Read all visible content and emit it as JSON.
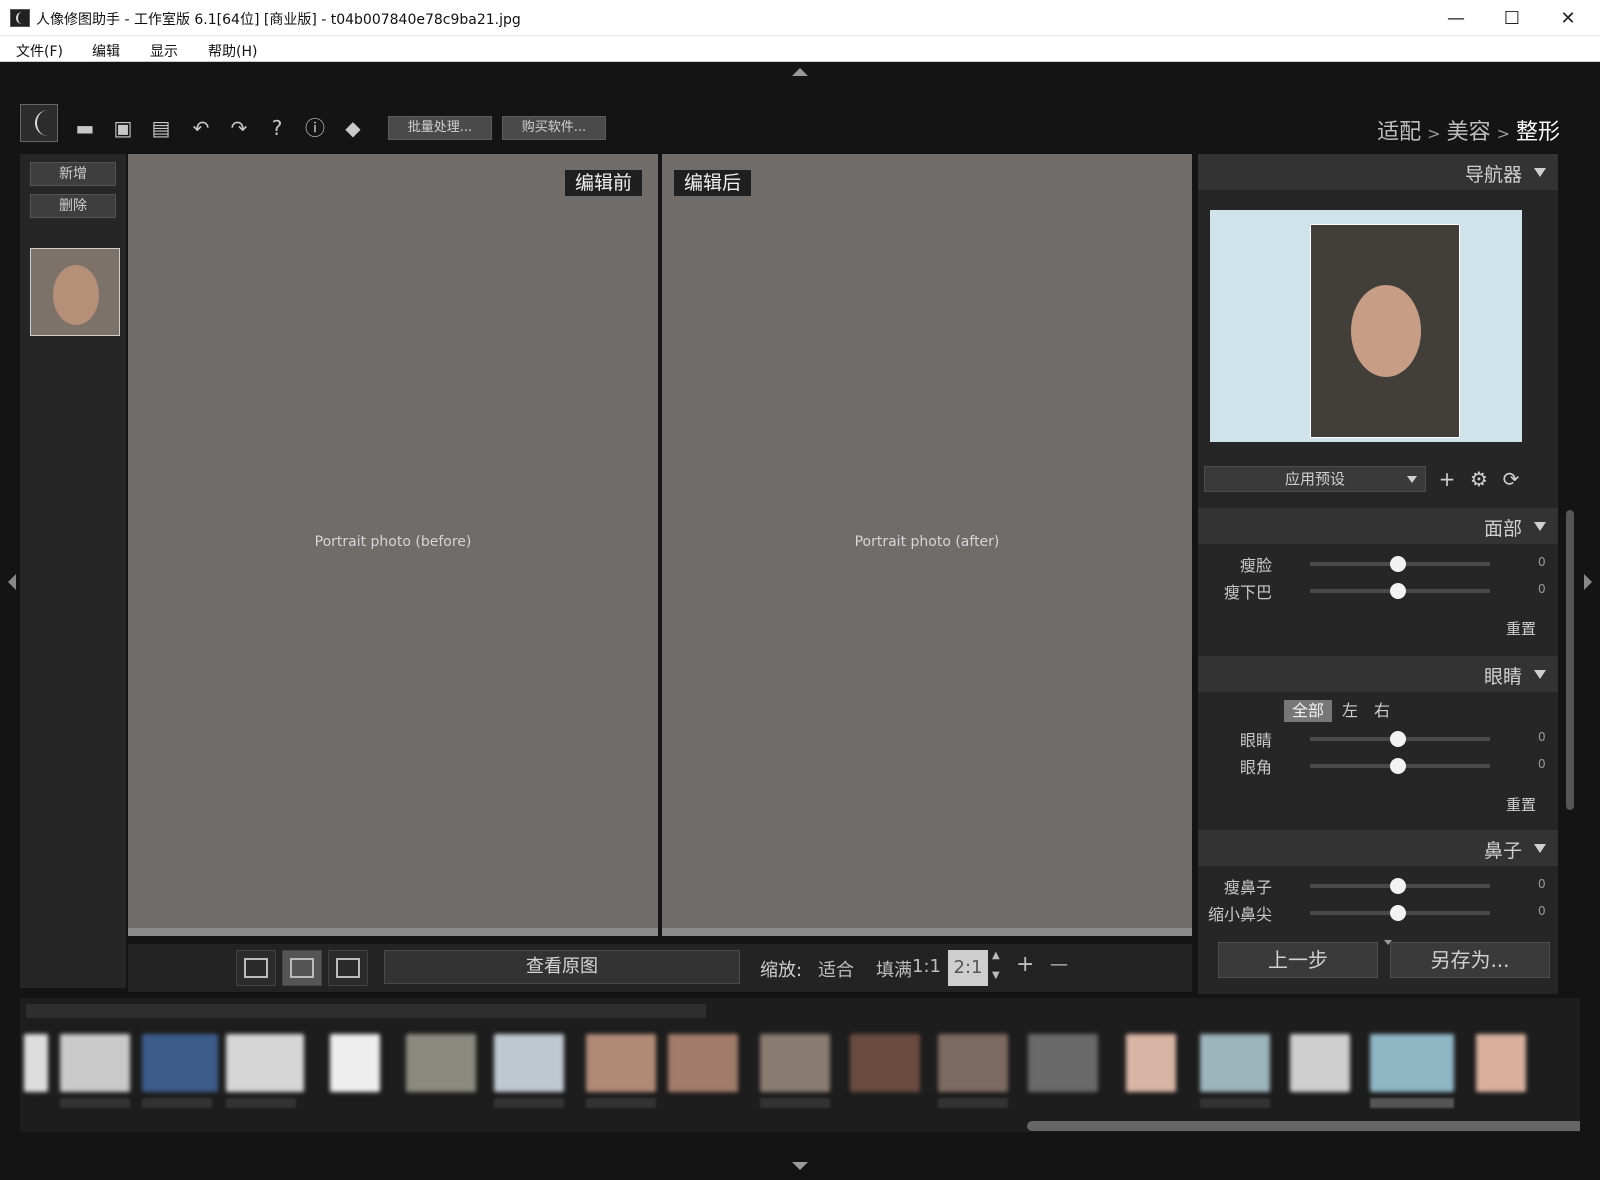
{
  "window": {
    "title": "人像修图助手 - 工作室版 6.1[64位] [商业版] - t04b007840e78c9ba21.jpg",
    "controls": {
      "minimize": "—",
      "maximize": "☐",
      "close": "✕"
    }
  },
  "menu": [
    "文件(F)",
    "编辑",
    "显示",
    "帮助(H)"
  ],
  "toolbar": {
    "icons": [
      "open-folder-icon",
      "save-icon",
      "save-as-icon",
      "undo-icon",
      "redo-icon",
      "help-icon",
      "info-icon",
      "plugin-icon"
    ],
    "icon_glyphs": {
      "help": "?",
      "info": "ⓘ",
      "undo": "↶",
      "redo": "↷",
      "open": "▬",
      "save": "▣",
      "saveas": "▤",
      "plugin": "◆"
    },
    "batch_label": "批量处理...",
    "buy_label": "购买软件..."
  },
  "breadcrumb": {
    "step1": "适配",
    "step2": "美容",
    "step3": "整形",
    "sep": ">"
  },
  "left_strip": {
    "add_label": "新增",
    "delete_label": "删除"
  },
  "views": {
    "before_label": "编辑前",
    "after_label": "编辑后",
    "placeholder": "Portrait photo (before)",
    "placeholder_after": "Portrait photo (after)"
  },
  "view_bar": {
    "view_original_label": "查看原图",
    "zoom_label": "缩放:",
    "zoom_fit": "适合",
    "zoom_fill": "填满",
    "zoom_1_1": "1:1",
    "zoom_value": "2:1",
    "plus": "+",
    "minus": "—",
    "spin_up": "▲",
    "spin_down": "▼"
  },
  "right_panel": {
    "navigator_title": "导航器",
    "preset_label": "应用预设",
    "preset_icons": {
      "add": "+",
      "settings": "⚙",
      "refresh": "⟳"
    },
    "face": {
      "title": "面部",
      "sliders": [
        {
          "label": "瘦脸",
          "value": "0"
        },
        {
          "label": "瘦下巴",
          "value": "0"
        }
      ],
      "reset_label": "重置"
    },
    "eyes": {
      "title": "眼睛",
      "tabs": [
        "全部",
        "左",
        "右"
      ],
      "sliders": [
        {
          "label": "眼睛",
          "value": "0"
        },
        {
          "label": "眼角",
          "value": "0"
        }
      ],
      "reset_label": "重置"
    },
    "nose": {
      "title": "鼻子",
      "sliders": [
        {
          "label": "瘦鼻子",
          "value": "0"
        },
        {
          "label": "缩小鼻尖",
          "value": "0"
        }
      ]
    },
    "prev_step_label": "上一步",
    "save_as_label": "另存为..."
  },
  "colors": {
    "background": "#141414",
    "panel": "#262626",
    "header": "#333333",
    "accent_active": "#ffffff"
  }
}
